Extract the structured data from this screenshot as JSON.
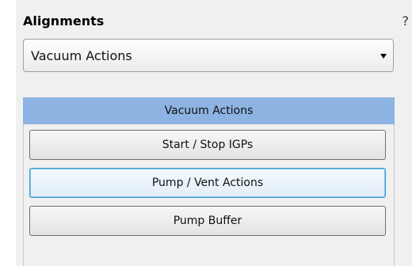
{
  "header": {
    "title": "Alignments",
    "help_label": "?"
  },
  "dropdown": {
    "selected": "Vacuum Actions"
  },
  "group": {
    "title": "Vacuum Actions",
    "buttons": [
      {
        "label": "Start / Stop IGPs"
      },
      {
        "label": "Pump / Vent Actions"
      },
      {
        "label": "Pump Buffer"
      }
    ]
  },
  "colors": {
    "group_header": "#8db3e2",
    "focus_border": "#3c9bd6"
  }
}
